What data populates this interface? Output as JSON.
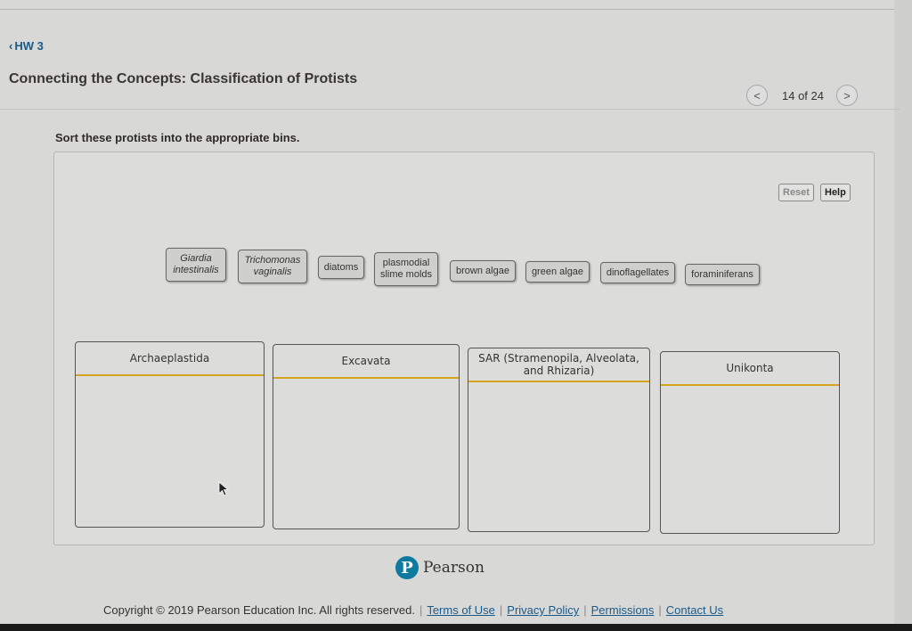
{
  "header": {
    "back_label": "HW 3",
    "title": "Connecting the Concepts: Classification of Protists",
    "pager": {
      "current": 14,
      "total": 24,
      "text": "14 of 24",
      "prev_icon": "<",
      "next_icon": ">"
    }
  },
  "instructions": "Sort these protists into the appropriate bins.",
  "toolbar": {
    "reset_label": "Reset",
    "help_label": "Help"
  },
  "chips": [
    {
      "label": "Giardia intestinalis",
      "italic": true
    },
    {
      "label": "Trichomonas vaginalis",
      "italic": true
    },
    {
      "label": "diatoms",
      "italic": false
    },
    {
      "label": "plasmodial slime molds",
      "italic": false
    },
    {
      "label": "brown algae",
      "italic": false
    },
    {
      "label": "green algae",
      "italic": false
    },
    {
      "label": "dinoflagellates",
      "italic": false
    },
    {
      "label": "foraminiferans",
      "italic": false
    }
  ],
  "bins": [
    {
      "label": "Archaeplastida"
    },
    {
      "label": "Excavata"
    },
    {
      "label": "SAR (Stramenopila, Alveolata, and Rhizaria)"
    },
    {
      "label": "Unikonta"
    }
  ],
  "branding": {
    "logo_letter": "P",
    "name": "Pearson"
  },
  "footer": {
    "copyright": "Copyright © 2019 Pearson Education Inc. All rights reserved.",
    "links": [
      "Terms of Use",
      "Privacy Policy",
      "Permissions",
      "Contact Us"
    ]
  },
  "colors": {
    "accent_link": "#1a5a8a",
    "bin_divider": "#d4a420",
    "pearson_blue": "#0e7aa0"
  }
}
